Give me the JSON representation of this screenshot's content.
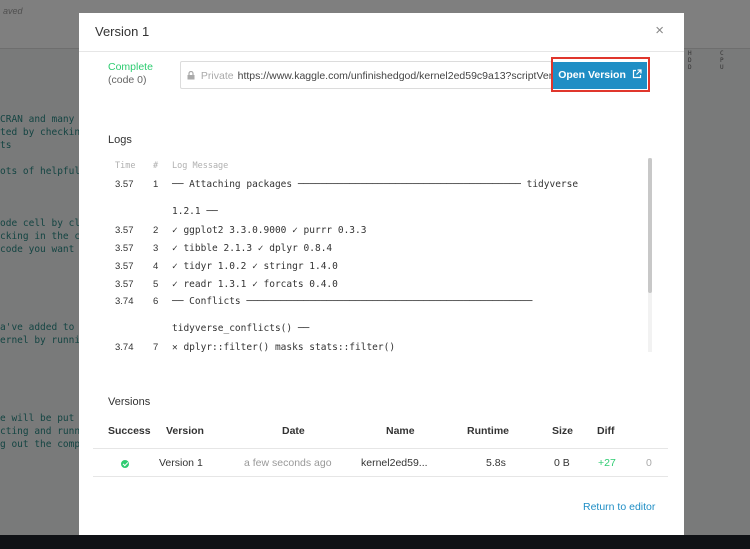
{
  "background": {
    "saved_text": "aved",
    "code_lines": [
      "",
      "CRAN and many",
      "ted by checkin",
      "ts",
      "",
      "ots of helpful",
      "",
      "",
      "",
      "ode cell by cl",
      "cking in the c",
      "code you want",
      "",
      "",
      "",
      "",
      "",
      "a've added to",
      "ernel by runni",
      "",
      "",
      "",
      "",
      "",
      "e will be put",
      "cting and runn",
      "g out the comp"
    ],
    "right_labels": [
      "H",
      "D",
      "D",
      "C",
      "P",
      "U"
    ]
  },
  "modal": {
    "title": "Version 1",
    "close_icon": "×",
    "status": {
      "label": "Complete",
      "code": "(code 0)"
    },
    "url": {
      "privacy": "Private",
      "value": "https://www.kaggle.com/unfinishedgod/kernel2ed59c9a13?scriptVersionId=11",
      "open_label": "Open Version"
    },
    "logs": {
      "label": "Logs",
      "headers": {
        "time": "Time",
        "num": "#",
        "message": "Log Message"
      },
      "rows": [
        {
          "time": "3.57",
          "num": "1",
          "msg": "── Attaching packages ─────────────────────────────────────── tidyverse"
        },
        {
          "time": "",
          "num": "",
          "msg": "1.2.1 ──"
        },
        {
          "time": "3.57",
          "num": "2",
          "msg": "✓ ggplot2 3.3.0.9000 ✓ purrr 0.3.3"
        },
        {
          "time": "3.57",
          "num": "3",
          "msg": "✓ tibble 2.1.3 ✓ dplyr 0.8.4"
        },
        {
          "time": "3.57",
          "num": "4",
          "msg": "✓ tidyr 1.0.2 ✓ stringr 1.4.0"
        },
        {
          "time": "3.57",
          "num": "5",
          "msg": "✓ readr 1.3.1 ✓ forcats 0.4.0"
        },
        {
          "time": "3.74",
          "num": "6",
          "msg": "── Conflicts ──────────────────────────────────────────────────"
        },
        {
          "time": "",
          "num": "",
          "msg": "tidyverse_conflicts() ──"
        },
        {
          "time": "3.74",
          "num": "7",
          "msg": "✕ dplyr::filter() masks stats::filter()"
        }
      ]
    },
    "versions": {
      "label": "Versions",
      "headers": [
        "Success",
        "Version",
        "Date",
        "Name",
        "Runtime",
        "Size",
        "Diff"
      ],
      "row": {
        "success": "check-icon",
        "version": "Version 1",
        "date": "a few seconds ago",
        "name": "kernel2ed59...",
        "runtime": "5.8s",
        "size": "0 B",
        "diff_add": "+27",
        "diff_del": "0"
      }
    },
    "return_label": "Return to editor"
  },
  "colors": {
    "accent": "#1f8ec5",
    "success": "#2ecc71",
    "highlight": "#e0362c"
  }
}
